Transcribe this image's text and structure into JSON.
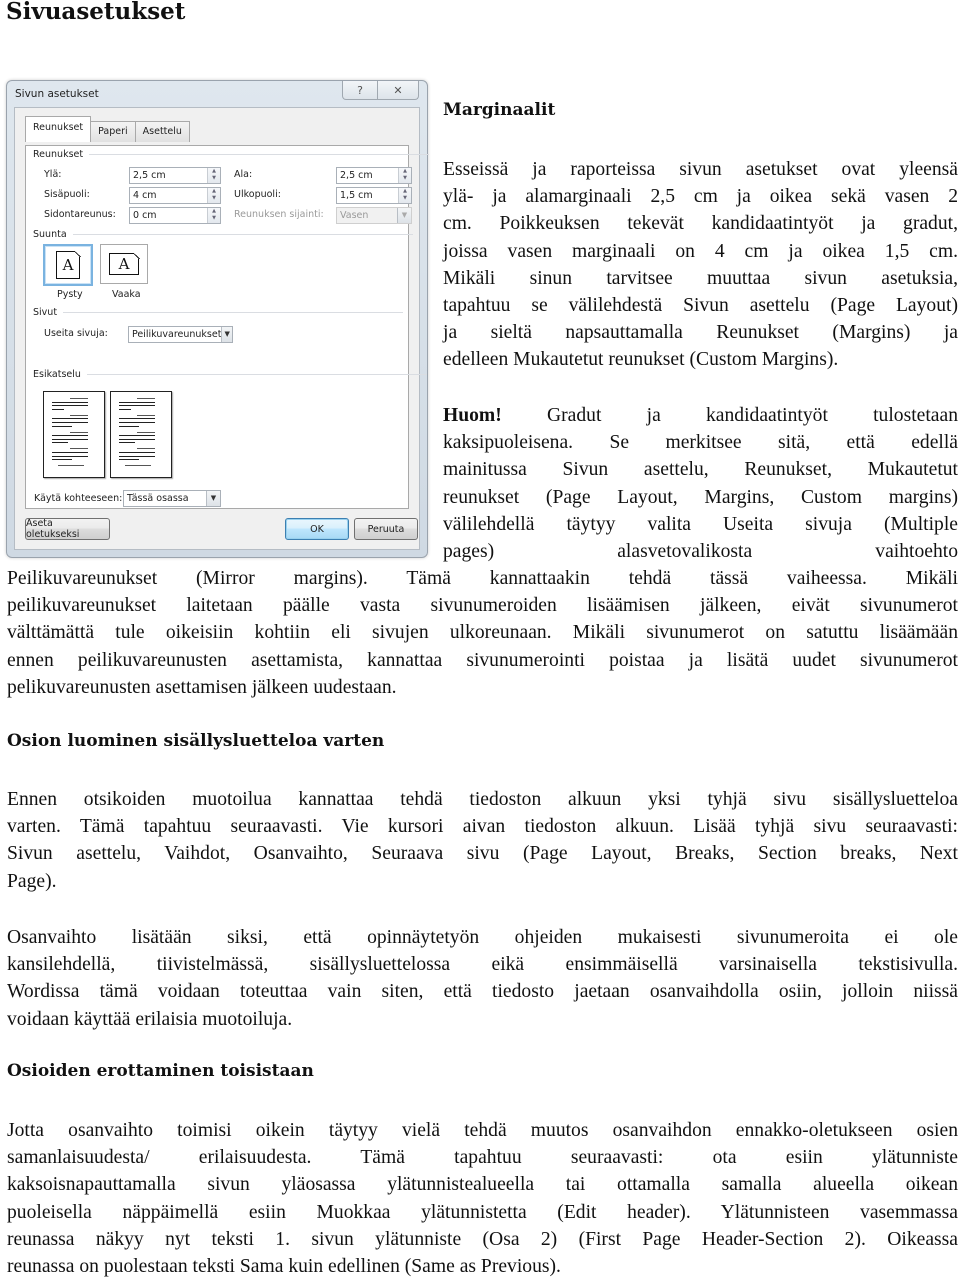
{
  "page_title": "Sivuasetukset",
  "dialog": {
    "title": "Sivun asetukset",
    "help_icon": "help-question-icon",
    "close_icon": "close-x-icon",
    "tabs": [
      {
        "label": "Reunukset",
        "active": true
      },
      {
        "label": "Paperi",
        "active": false
      },
      {
        "label": "Asettelu",
        "active": false
      }
    ],
    "margins_group": "Reunukset",
    "fields": {
      "top": {
        "label": "Ylä:",
        "value": "2,5 cm"
      },
      "bottom": {
        "label": "Ala:",
        "value": "2,5 cm"
      },
      "inside": {
        "label": "Sisäpuoli:",
        "value": "4 cm"
      },
      "outside": {
        "label": "Ulkopuoli:",
        "value": "1,5 cm"
      },
      "gutter": {
        "label": "Sidontareunus:",
        "value": "0 cm"
      },
      "gutter_position": {
        "label": "Reunuksen sijainti:",
        "value": "Vasen",
        "disabled": true
      }
    },
    "orientation_group": "Suunta",
    "orientation": {
      "portrait": "Pysty",
      "landscape": "Vaaka",
      "selected": "Pysty",
      "glyph": "A"
    },
    "pages_group": "Sivut",
    "multiple_pages": {
      "label": "Useita sivuja:",
      "value": "Peilikuvareunukset"
    },
    "preview_group": "Esikatselu",
    "apply_to": {
      "label": "Käytä kohteeseen:",
      "value": "Tässä osassa"
    },
    "buttons": {
      "set_default": "Aseta oletukseksi",
      "ok": "OK",
      "cancel": "Peruuta"
    }
  },
  "sections": {
    "marginaalit": {
      "heading": "Marginaalit",
      "p1_lines": [
        "Esseissä ja raporteissa sivun asetukset ovat yleensä",
        "ylä- ja alamarginaali 2,5 cm ja oikea sekä vasen 2",
        "cm. Poikkeuksen tekevät kandidaatintyöt ja gradut,",
        "joissa vasen marginaali on 4 cm ja oikea 1,5 cm.",
        "Mikäli sinun tarvitsee muuttaa sivun asetuksia,",
        "tapahtuu se välilehdestä Sivun asettelu (Page Layout)",
        "ja sieltä napsauttamalla Reunukset (Margins) ja",
        "edelleen Mukautetut reunukset (Custom Margins)."
      ],
      "note_bold": "Huom!",
      "note_first_line_rest": " Gradut ja kandidaatintyöt tulostetaan",
      "note_lines": [
        "kaksipuoleisena. Se merkitsee sitä, että edellä",
        "mainitussa Sivun asettelu, Reunukset, Mukautetut",
        "reunukset (Page Layout, Margins, Custom margins)",
        "välilehdellä täytyy valita Useita sivuja (Multiple",
        "pages) alasvetovalikosta vaihtoehto"
      ],
      "note_full_lines": [
        "Peilikuvareunukset (Mirror margins). Tämä kannattaakin tehdä tässä vaiheessa. Mikäli",
        "peilikuvareunukset laitetaan päälle vasta sivunumeroiden lisäämisen jälkeen, eivät sivunumerot",
        "välttämättä tule oikeisiin kohtiin eli sivujen ulkoreunaan. Mikäli sivunumerot on satuttu lisäämään",
        "ennen peilikuvareunusten asettamista, kannattaa sivunumerointi poistaa  ja lisätä uudet sivunumerot",
        "pelikuvareunusten asettamisen jälkeen uudestaan."
      ]
    },
    "osion_luominen": {
      "heading": "Osion luominen sisällysluetteloa varten",
      "p1_lines": [
        "Ennen otsikoiden muotoilua kannattaa tehdä tiedoston alkuun yksi tyhjä sivu sisällysluetteloa",
        "varten. Tämä tapahtuu seuraavasti. Vie kursori aivan tiedoston alkuun. Lisää tyhjä sivu seuraavasti:",
        "Sivun asettelu, Vaihdot, Osanvaihto, Seuraava sivu (Page Layout, Breaks, Section breaks, Next",
        "Page)."
      ],
      "p2_lines": [
        "Osanvaihto lisätään siksi, että opinnäytetyön ohjeiden mukaisesti sivunumeroita ei ole",
        "kansilehdellä, tiivistelmässä, sisällysluettelossa eikä ensimmäisellä varsinaisella tekstisivulla.",
        "Wordissa tämä voidaan toteuttaa vain siten, että tiedosto jaetaan osanvaihdolla osiin, jolloin niissä",
        "voidaan käyttää erilaisia muotoiluja."
      ]
    },
    "osioiden_erottaminen": {
      "heading": "Osioiden erottaminen toisistaan",
      "p1_lines": [
        "Jotta osanvaihto toimisi oikein täytyy vielä tehdä muutos osanvaihdon ennakko-oletukseen osien",
        "samanlaisuudesta/ erilaisuudesta. Tämä tapahtuu seuraavasti: ota esiin ylätunniste",
        "kaksoisnapauttamalla sivun yläosassa ylätunnistealueella tai ottamalla samalla alueella oikean",
        "puoleisella näppäimellä esiin Muokkaa ylätunnistetta (Edit header). Ylätunnisteen vasemmassa",
        "reunassa näkyy nyt teksti 1. sivun ylätunniste (Osa 2) (First Page Header-Section 2). Oikeassa",
        "reunassa on puolestaan teksti Sama kuin edellinen (Same as Previous)."
      ]
    }
  }
}
